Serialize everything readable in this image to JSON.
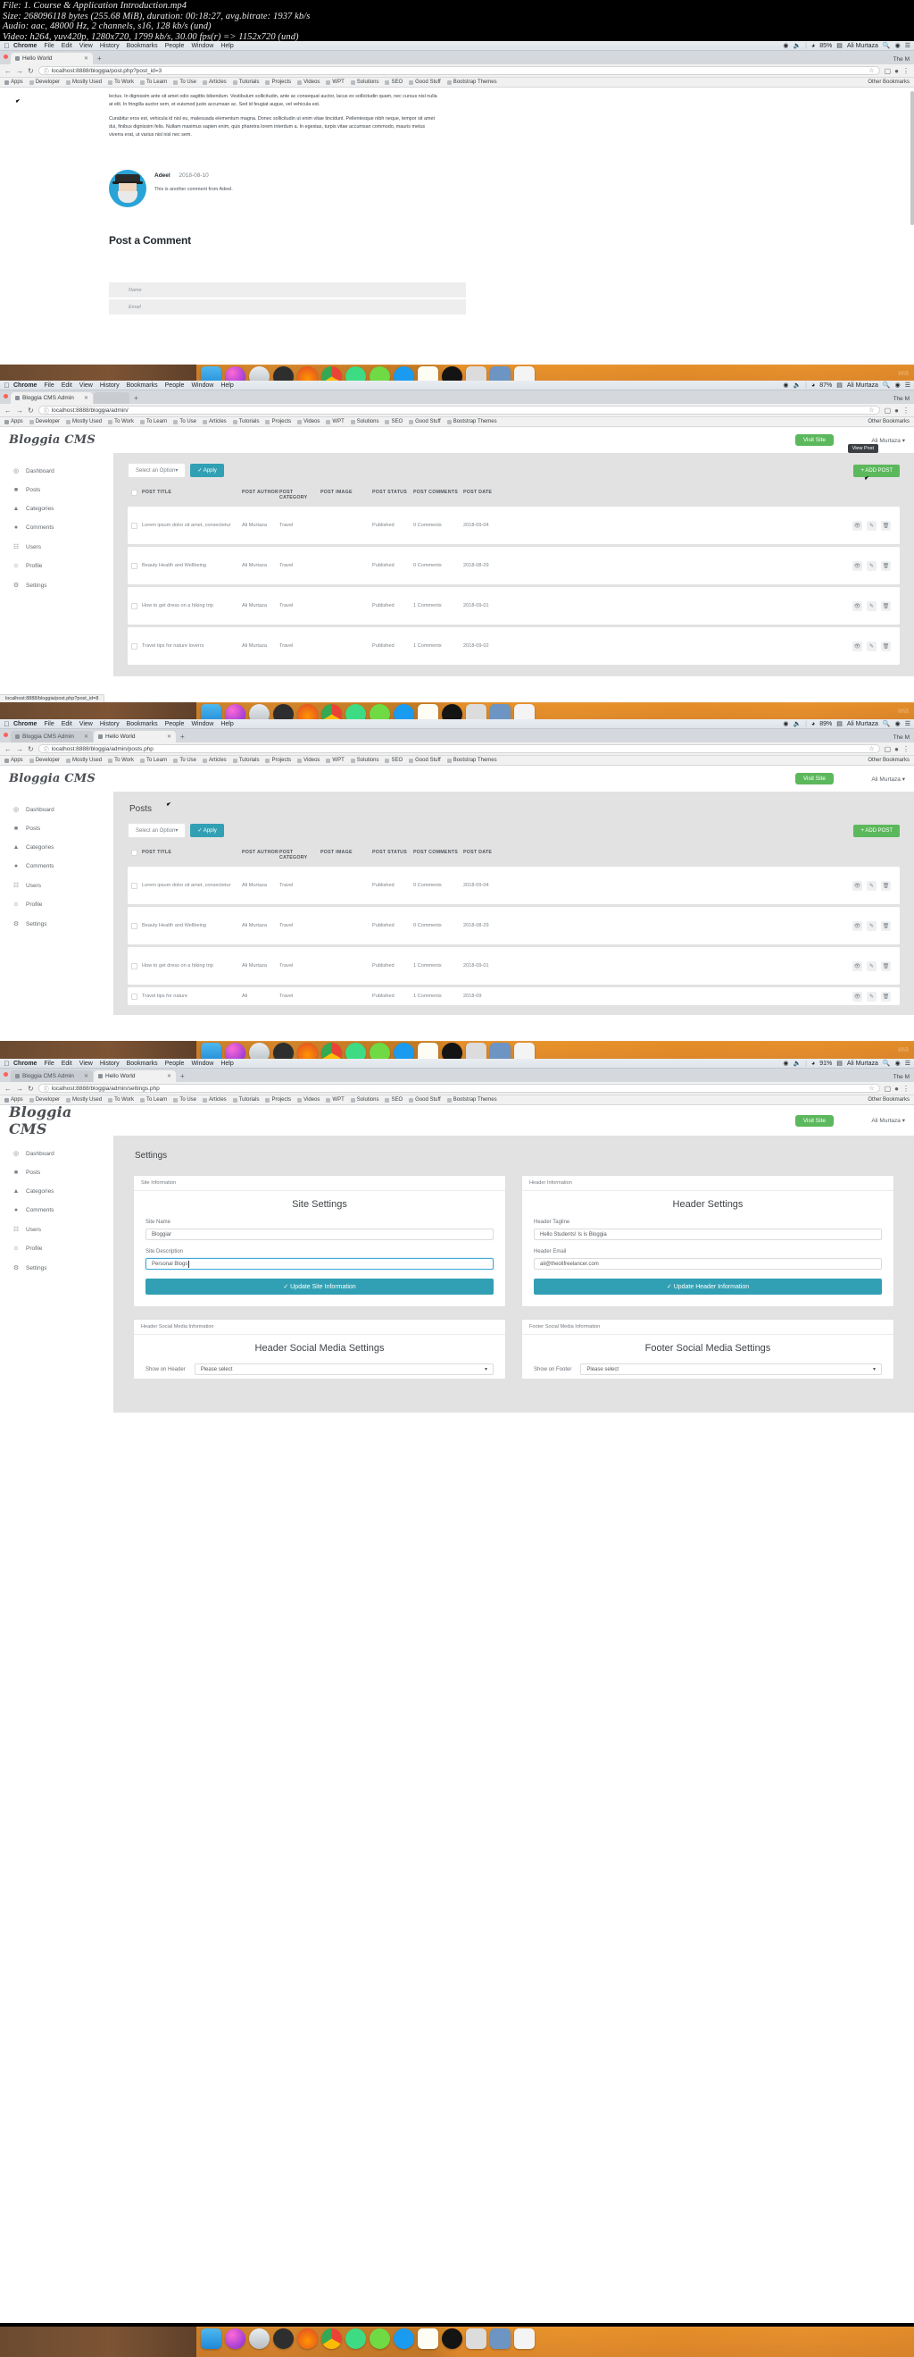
{
  "video_info": {
    "file": "File: 1. Course & Application Introduction.mp4",
    "size": "Size: 268096118 bytes (255.68 MiB), duration: 00:18:27, avg.bitrate: 1937 kb/s",
    "audio": "Audio: aac, 48000 Hz, 2 channels, s16, 128 kb/s (und)",
    "video": "Video: h264, yuv420p, 1280x720, 1799 kb/s, 30.00 fps(r) => 1152x720 (und)"
  },
  "menubar": {
    "apple": "apple-icon",
    "app": "Chrome",
    "items": [
      "File",
      "Edit",
      "View",
      "History",
      "Bookmarks",
      "People",
      "Window",
      "Help"
    ],
    "right": {
      "battery_85": "85%",
      "battery_87": "87%",
      "battery_89": "89%",
      "battery_91": "91%",
      "user": "Ali Murtaza",
      "search_icon": "search-icon",
      "siri_icon": "siri-icon",
      "menu_icon": "control-center-icon"
    }
  },
  "bookmarks": [
    {
      "label": "Apps",
      "icon": "apps-icon"
    },
    {
      "label": "Developer",
      "icon": "folder-icon"
    },
    {
      "label": "Mostly Used",
      "icon": "folder-icon"
    },
    {
      "label": "To Work",
      "icon": "folder-icon"
    },
    {
      "label": "To Learn",
      "icon": "folder-icon"
    },
    {
      "label": "To Use",
      "icon": "folder-icon"
    },
    {
      "label": "Articles",
      "icon": "folder-icon"
    },
    {
      "label": "Tutorials",
      "icon": "folder-icon"
    },
    {
      "label": "Projects",
      "icon": "folder-icon"
    },
    {
      "label": "Videos",
      "icon": "folder-icon"
    },
    {
      "label": "WPT",
      "icon": "folder-icon"
    },
    {
      "label": "Solutions",
      "icon": "folder-icon"
    },
    {
      "label": "SEO",
      "icon": "folder-icon"
    },
    {
      "label": "Good Stuff",
      "icon": "folder-icon"
    },
    {
      "label": "Bootstrap Themes",
      "icon": "folder-icon"
    }
  ],
  "bookmarks_other": "Other Bookmarks",
  "panel1": {
    "tab": "Hello World",
    "window_right": "The M",
    "url": "localhost:8888/bloggia/post.php?post_id=3",
    "paragraphs": [
      "lectus. In dignissim ante sit amet odio sagittis bibendum. Vestibulum sollicitudin, ante ac consequat auctor, lacus ex sollicitudin quam, nec cursus nisl nulla at elit. In fringilla auctor sem, et euismod justo accumsan ac. Sed id feugiat augue, vel vehicula est.",
      "Curabitur eros est, vehicula id nisl eu, malesuada elementum magna. Donec sollicitudin ut enim vitae tincidunt. Pellentesque nibh neque, tempor sit amet dui, finibus dignissim felis. Nullam maximus sapien enim, quis pharetra lorem interdum a. In egestas, turpis vitae accumsan commodo, mauris metus viverra erat, ut varius nisl nisl nec sem."
    ],
    "comment": {
      "author": "Adeel",
      "date": "2018-08-10",
      "text": "This is another comment from Adeel.",
      "avatar": "user-avatar"
    },
    "post_a_comment": "Post a Comment",
    "form": {
      "name_placeholder": "Name",
      "email_placeholder": "Email"
    }
  },
  "panel2": {
    "tabs": [
      {
        "label": "Bloggia CMS Admin",
        "active": true
      },
      {
        "label": "",
        "active": false
      }
    ],
    "window_right": "The M",
    "url": "localhost:8888/bloggia/admin/",
    "status_url": "localhost:8888/bloggia/post.php?post_id=8",
    "brand": "Bloggia CMS",
    "visit_site": "Visit Site",
    "user": "Ali Murtaza",
    "sidebar": [
      {
        "label": "Dashboard",
        "icon": "dashboard-icon"
      },
      {
        "label": "Posts",
        "icon": "posts-icon"
      },
      {
        "label": "Categories",
        "icon": "categories-icon"
      },
      {
        "label": "Comments",
        "icon": "comments-icon"
      },
      {
        "label": "Users",
        "icon": "users-icon"
      },
      {
        "label": "Profile",
        "icon": "profile-icon"
      },
      {
        "label": "Settings",
        "icon": "settings-icon"
      }
    ],
    "select_option": "Select an Option",
    "apply": "Apply",
    "add_post": "+ ADD POST",
    "tooltip": "View Post",
    "columns": [
      "POST TITLE",
      "POST AUTHOR",
      "POST CATEGORY",
      "POST IMAGE",
      "POST STATUS",
      "POST COMMENTS",
      "POST DATE"
    ],
    "rows": [
      {
        "title": "Lorem ipsum dolor sit amet, consectetur",
        "author": "Ali Murtaza",
        "category": "Travel",
        "status": "Published",
        "comments": "0 Comments",
        "date": "2018-09-04",
        "image": "post-thumbnail"
      },
      {
        "title": "Beauty Health and Wellbeing",
        "author": "Ali Murtaza",
        "category": "Travel",
        "status": "Published",
        "comments": "0 Comments",
        "date": "2018-08-29",
        "image": "post-thumbnail"
      },
      {
        "title": "How to get dress on a hiking trip",
        "author": "Ali Murtaza",
        "category": "Travel",
        "status": "Published",
        "comments": "1 Comments",
        "date": "2018-09-01",
        "image": "post-thumbnail"
      },
      {
        "title": "Travel tips for nature loverrs",
        "author": "Ali Murtaza",
        "category": "Travel",
        "status": "Published",
        "comments": "1 Comments",
        "date": "2018-09-02",
        "image": "post-thumbnail"
      }
    ]
  },
  "panel3": {
    "tabs": [
      {
        "label": "Bloggia CMS Admin",
        "active": false
      },
      {
        "label": "Hello World",
        "active": true
      }
    ],
    "window_right": "The M",
    "url": "localhost:8888/bloggia/admin/posts.php",
    "page_title": "Posts",
    "brand": "Bloggia CMS",
    "visit_site": "Visit Site",
    "user": "Ali Murtaza",
    "select_option": "Select an Option",
    "apply": "Apply",
    "add_post": "+ ADD POST",
    "columns": [
      "POST TITLE",
      "POST AUTHOR",
      "POST CATEGORY",
      "POST IMAGE",
      "POST STATUS",
      "POST COMMENTS",
      "POST DATE"
    ],
    "rows": [
      {
        "title": "Lorem ipsum dolor sit amet, consectetur",
        "author": "Ali Murtaza",
        "category": "Travel",
        "status": "Published",
        "comments": "0 Comments",
        "date": "2018-09-04",
        "image": "post-thumbnail"
      },
      {
        "title": "Beauty Health and Wellbeing",
        "author": "Ali Murtaza",
        "category": "Travel",
        "status": "Published",
        "comments": "0 Comments",
        "date": "2018-08-29",
        "image": "post-thumbnail"
      },
      {
        "title": "How to get dress on a hiking trip",
        "author": "Ali Murtaza",
        "category": "Travel",
        "status": "Published",
        "comments": "1 Comments",
        "date": "2018-09-01",
        "image": "post-thumbnail"
      },
      {
        "title": "Travel tips for nature",
        "author": "Ali",
        "category": "Travel",
        "status": "Published",
        "comments": "1 Comments",
        "date": "2018-09",
        "image": "post-thumbnail"
      }
    ]
  },
  "panel4": {
    "tabs": [
      {
        "label": "Bloggia CMS Admin",
        "active": false
      },
      {
        "label": "Hello World",
        "active": true
      }
    ],
    "window_right": "The M",
    "url": "localhost:8888/bloggia/admin/settings.php",
    "brand": "Bloggia CMS",
    "visit_site": "Visit Site",
    "user": "Ali Murtaza",
    "page_title": "Settings",
    "cards": [
      {
        "header": "Site Information",
        "title": "Site Settings",
        "fields": [
          {
            "label": "Site Name",
            "value": "Bloggiar",
            "focused": false
          },
          {
            "label": "Site Description",
            "value": "Personal Blogs",
            "focused": true
          }
        ],
        "button": "Update Site Information"
      },
      {
        "header": "Header Information",
        "title": "Header Settings",
        "fields": [
          {
            "label": "Header Tagline",
            "value": "Hello Students! Is is Bloggia",
            "focused": false
          },
          {
            "label": "Header Email",
            "value": "ali@theolifreelancer.com",
            "focused": false
          }
        ],
        "button": "Update Header Information"
      }
    ],
    "cards2": [
      {
        "header": "Header Social Media Information",
        "title": "Header Social Media Settings",
        "label": "Show on Header",
        "value": "Please select"
      },
      {
        "header": "Footer Social Media Information",
        "title": "Footer Social Media Settings",
        "label": "Show on Footer",
        "value": "Please select"
      }
    ]
  },
  "colors": {
    "teal": "#31a0b4",
    "green": "#5cb85c",
    "dock_orange": "#e08a2a"
  }
}
